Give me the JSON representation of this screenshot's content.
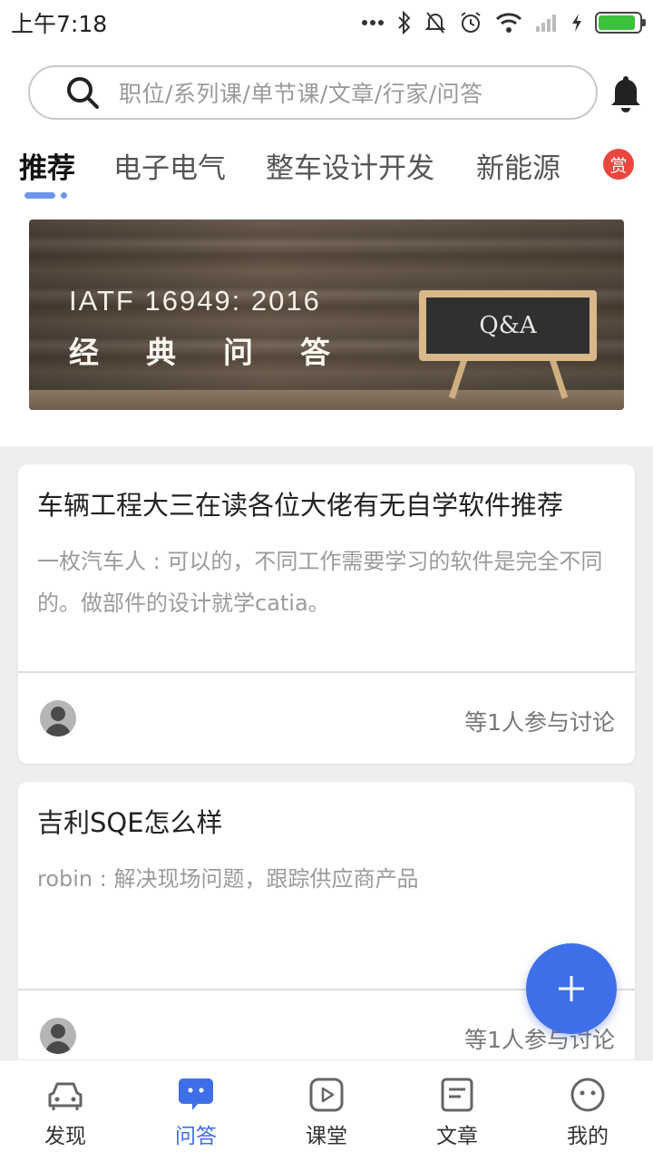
{
  "status_bar": {
    "time": "上午7:18",
    "icons": [
      "more-dots-icon",
      "bluetooth-icon",
      "mute-bell-icon",
      "alarm-icon",
      "wifi-icon",
      "signal-icon",
      "charging-icon",
      "battery-icon"
    ],
    "battery_level": 0.9
  },
  "search": {
    "placeholder": "职位/系列课/单节课/文章/行家/问答",
    "icon": "search-icon"
  },
  "header": {
    "notification_icon": "bell-icon"
  },
  "tabs": [
    {
      "label": "推荐",
      "active": true
    },
    {
      "label": "电子电气",
      "active": false
    },
    {
      "label": "整车设计开发",
      "active": false
    },
    {
      "label": "新能源",
      "active": false
    }
  ],
  "reward_badge": "赏",
  "banner": {
    "title": "IATF 16949: 2016",
    "subtitle": "经典问答",
    "board_text": "Q&A"
  },
  "posts": [
    {
      "title": "车辆工程大三在读各位大佬有无自学软件推荐",
      "excerpt": "一枚汽车人 : 可以的，不同工作需要学习的软件是完全不同的。做部件的设计就学catia。",
      "meta": "等1人参与讨论"
    },
    {
      "title": "吉利SQE怎么样",
      "excerpt": "robin : 解决现场问题，跟踪供应商产品",
      "meta": "等1人参与讨论"
    }
  ],
  "fab_icon": "plus-icon",
  "bottom_nav": [
    {
      "label": "发现",
      "icon": "car-icon",
      "active": false
    },
    {
      "label": "问答",
      "icon": "chat-bubble-icon",
      "active": true
    },
    {
      "label": "课堂",
      "icon": "play-icon",
      "active": false
    },
    {
      "label": "文章",
      "icon": "document-icon",
      "active": false
    },
    {
      "label": "我的",
      "icon": "face-icon",
      "active": false
    }
  ],
  "colors": {
    "accent": "#3f6fe8",
    "tab_indicator": "#6c97e6",
    "badge": "#e9463e",
    "battery": "#3bc13b"
  }
}
